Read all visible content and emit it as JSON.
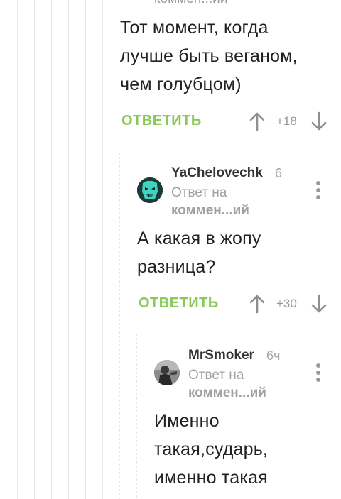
{
  "comment0": {
    "reply_ref_clip": "коммен...ий",
    "text_lines": [
      "Тот момент, когда",
      "лучше быть веганом,",
      "чем голубцом)"
    ],
    "reply_label": "ОТВЕТИТЬ",
    "rating": "+18"
  },
  "comment1": {
    "author": "YaChelovechk",
    "time": "6",
    "reply_to": "Ответ на",
    "reply_ref": "коммен...ий",
    "text_lines": [
      "А какая в жопу",
      "разница?"
    ],
    "reply_label": "ОТВЕТИТЬ",
    "rating": "+30"
  },
  "comment2": {
    "author": "MrSmoker",
    "time": "6ч",
    "reply_to": "Ответ на",
    "reply_ref": "коммен...ий",
    "text_lines": [
      "Именно",
      "такая,сударь,",
      "именно такая"
    ]
  },
  "icons": {
    "upvote": "arrow-up-icon",
    "downvote": "arrow-down-icon",
    "menu": "more-vertical-icon"
  },
  "colors": {
    "accent": "#8ac858",
    "muted": "#9a9a9a",
    "text": "#222222"
  }
}
